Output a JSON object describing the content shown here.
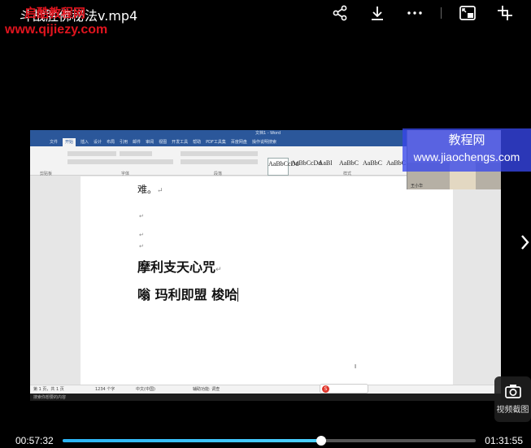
{
  "header": {
    "title": "斗战胜佛秘法v.mp4",
    "watermark_top": "启酷教程网",
    "watermark_url": "www.qijiezy.com"
  },
  "toolbar": {
    "icons": [
      "share-icon",
      "download-icon",
      "more-icon",
      "pip-icon",
      "fullscreen-exit-icon"
    ]
  },
  "video": {
    "word": {
      "doc_title": "文档1 - Word",
      "tabs": [
        "文件",
        "开始",
        "插入",
        "设计",
        "布局",
        "引用",
        "邮件",
        "审阅",
        "视图",
        "开发工具",
        "帮助",
        "PDF工具集",
        "百度网盘",
        "操作说明搜索"
      ],
      "active_tab": "开始",
      "styles": [
        "AaBbCcDd",
        "AaBbCcDd",
        "AaBl",
        "AaBbC",
        "AaBbC",
        "AaBbC"
      ],
      "groups": {
        "clipboard": "剪贴板",
        "font": "字体",
        "paragraph": "段落",
        "styles": "样式"
      },
      "prev_text": "难。",
      "heading": "摩利支天心咒",
      "mantra": "嗡 玛利即盟 梭哈",
      "return_mark": "↵",
      "status": {
        "page": "第 1 页，共 1 页",
        "words": "1234 个字",
        "lang": "中文(中国)",
        "accessibility": "辅助功能: 调查"
      },
      "taskbar": "搜索你想要的内容"
    },
    "webcam_label": "王小华"
  },
  "banner": {
    "line1": "教程网",
    "line2": "www.jiaochengs.com"
  },
  "snapshot": {
    "label": "视频截图"
  },
  "playback": {
    "current": "00:57:32",
    "total": "01:31:55",
    "progress": 0.626
  }
}
